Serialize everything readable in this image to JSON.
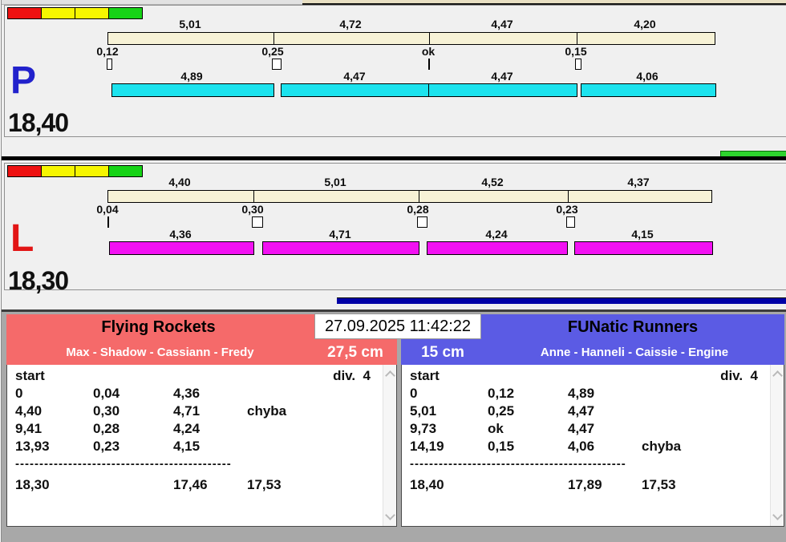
{
  "datetime": "27.09.2025 11:42:22",
  "colors": {
    "signal_strip": [
      "#ee1111",
      "#f6f600",
      "#f6f600",
      "#16d316"
    ],
    "split_bar_bg": "#f7f2d6",
    "progress_bar": "#0000a6",
    "green_indicator": "#2dd42d"
  },
  "lanes": [
    {
      "letter": "P",
      "letter_color": "#2222cc",
      "total": "18,40",
      "bar_color": "#1ce3ee",
      "splits_top": [
        {
          "label": "5,01",
          "value": 5.01
        },
        {
          "label": "4,72",
          "value": 4.72
        },
        {
          "label": "4,47",
          "value": 4.47
        },
        {
          "label": "4,20",
          "value": 4.2
        }
      ],
      "exchanges": [
        {
          "label": "0,12",
          "value": 0.12,
          "mark": "box"
        },
        {
          "label": "0,25",
          "value": 0.25,
          "mark": "box"
        },
        {
          "label": "ok",
          "value": 0,
          "mark": "line"
        },
        {
          "label": "0,15",
          "value": 0.15,
          "mark": "box"
        }
      ],
      "splits_bottom": [
        {
          "label": "4,89",
          "value": 4.89
        },
        {
          "label": "4,47",
          "value": 4.47
        },
        {
          "label": "4,47",
          "value": 4.47
        },
        {
          "label": "4,06",
          "value": 4.06
        }
      ]
    },
    {
      "letter": "L",
      "letter_color": "#e21515",
      "total": "18,30",
      "bar_color": "#f211f2",
      "splits_top": [
        {
          "label": "4,40",
          "value": 4.4
        },
        {
          "label": "5,01",
          "value": 5.01
        },
        {
          "label": "4,52",
          "value": 4.52
        },
        {
          "label": "4,37",
          "value": 4.37
        }
      ],
      "exchanges": [
        {
          "label": "0,04",
          "value": 0.04,
          "mark": "line"
        },
        {
          "label": "0,30",
          "value": 0.3,
          "mark": "box"
        },
        {
          "label": "0,28",
          "value": 0.28,
          "mark": "box"
        },
        {
          "label": "0,23",
          "value": 0.23,
          "mark": "box"
        }
      ],
      "splits_bottom": [
        {
          "label": "4,36",
          "value": 4.36
        },
        {
          "label": "4,71",
          "value": 4.71
        },
        {
          "label": "4,24",
          "value": 4.24
        },
        {
          "label": "4,15",
          "value": 4.15
        }
      ]
    }
  ],
  "teams": [
    {
      "name": "Flying Rockets",
      "members": "Max - Shadow - Cassiann - Fredy",
      "handicap": "27,5 cm",
      "header_color": "#f56a6a",
      "start_label": "start",
      "division_label": "div.  4",
      "rows": [
        [
          "0",
          "0,04",
          "4,36",
          ""
        ],
        [
          "4,40",
          "0,30",
          "4,71",
          "chyba"
        ],
        [
          "9,41",
          "0,28",
          "4,24",
          ""
        ],
        [
          "13,93",
          "0,23",
          "4,15",
          ""
        ]
      ],
      "separator": "---------------------------------------------",
      "totals": [
        "18,30",
        "",
        "17,46",
        "17,53"
      ]
    },
    {
      "name": "FUNatic Runners",
      "members": "Anne - Hanneli - Caissie - Engine",
      "handicap": "15 cm",
      "header_color": "#5b5be4",
      "start_label": "start",
      "division_label": "div.  4",
      "rows": [
        [
          "0",
          "0,12",
          "4,89",
          ""
        ],
        [
          "5,01",
          "0,25",
          "4,47",
          ""
        ],
        [
          "9,73",
          "ok",
          "4,47",
          ""
        ],
        [
          "14,19",
          "0,15",
          "4,06",
          "chyba"
        ]
      ],
      "separator": "---------------------------------------------",
      "totals": [
        "18,40",
        "",
        "17,89",
        "17,53"
      ]
    }
  ]
}
